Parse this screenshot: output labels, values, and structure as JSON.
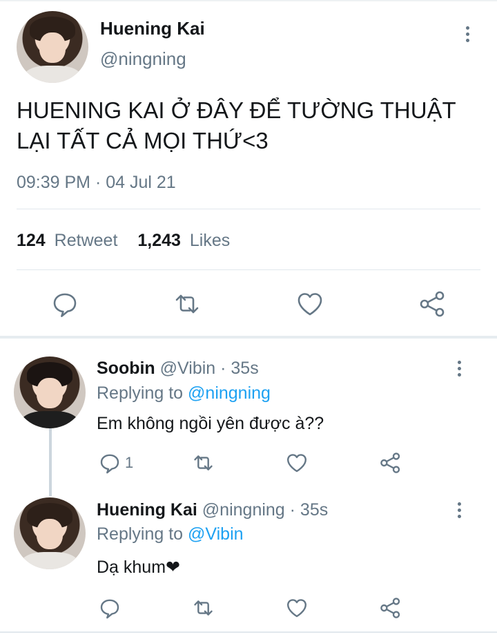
{
  "main_tweet": {
    "author_name": "Huening Kai",
    "handle": "@ningning",
    "text_line1": "HUENING KAI Ở ĐÂY ĐỂ TƯỜNG THUẬT",
    "text_line2": "LẠI TẤT CẢ MỌI THỨ<3",
    "timestamp": "09:39 PM · 04 Jul 21",
    "retweet_count": "124",
    "retweet_label": "Retweet",
    "like_count": "1,243",
    "like_label": "Likes",
    "actions": [
      "reply-icon",
      "retweet-icon",
      "like-icon",
      "share-icon"
    ]
  },
  "replies": [
    {
      "author_name": "Soobin",
      "handle_time": "@Vibin · 35s",
      "replying_prefix": "Replying to",
      "replying_to": "@ningning",
      "text": "Em không ngồi yên được à??",
      "reply_count": "1"
    },
    {
      "author_name": "Huening Kai",
      "handle_time": "@ningning · 35s",
      "replying_prefix": "Replying to",
      "replying_to": "@Vibin",
      "text": "Dạ khum❤",
      "reply_count": ""
    }
  ],
  "colors": {
    "accent": "#1da1f2",
    "muted": "#657786",
    "divider": "#e1e8ed"
  }
}
